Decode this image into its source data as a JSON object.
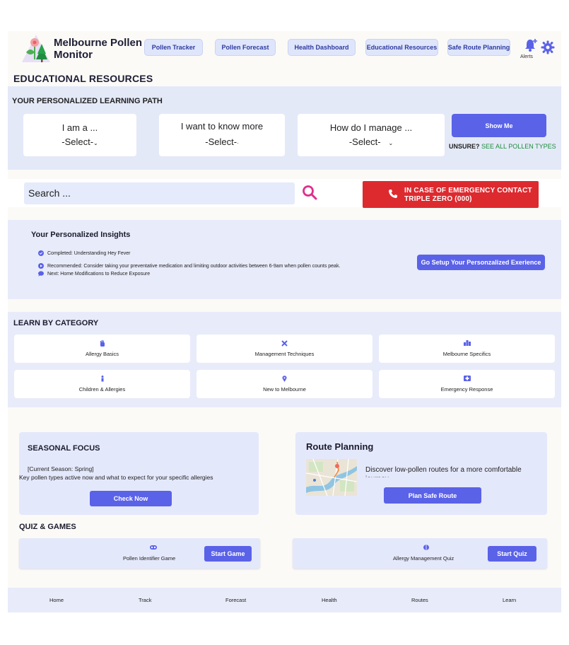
{
  "app": {
    "name_line1": "Melbourne Pollen",
    "name_line2": "Monitor"
  },
  "colors": {
    "primary": "#5a62e8",
    "nav_button_bg": "#dfe6fb",
    "emergency": "#dd2a2f",
    "section_bg": "#e8ebf9",
    "link_green": "#1d8e3b"
  },
  "nav": {
    "items": [
      {
        "label": "Pollen Tracker"
      },
      {
        "label": "Pollen Forecast"
      },
      {
        "label": "Health Dashboard"
      },
      {
        "label": "Educational Resources"
      },
      {
        "label": "Safe Route Planning"
      }
    ],
    "alerts_label": "Alerts",
    "alerts_icon": "bell-plus-icon",
    "settings_icon": "gear-icon"
  },
  "page_title": "EDUCATIONAL RESOURCES",
  "learning_path": {
    "title": "YOUR PERSONALIZED LEARNING PATH",
    "selectors": [
      {
        "prompt": "I am a ...",
        "value": "-Select-"
      },
      {
        "prompt": "I want to know more",
        "value": "-Select-"
      },
      {
        "prompt": "How do I manage ...",
        "value": "-Select-"
      }
    ],
    "show_me": "Show Me",
    "unsure_prefix": "UNSURE?",
    "unsure_link": "SEE ALL POLLEN TYPES"
  },
  "search": {
    "placeholder": "Search ...",
    "icon": "search-icon"
  },
  "emergency": {
    "line1": "IN CASE OF EMERGENCY CONTACT",
    "line2": "TRIPLE ZERO (000)",
    "icon": "phone-icon"
  },
  "insights": {
    "title": "Your Personalized Insights",
    "items": [
      {
        "icon": "check-circle-icon",
        "text": "Completed: Understanding Hey Fever"
      },
      {
        "icon": "play-circle-icon",
        "text": "Recommended: Consider taking your preventative medication and limiting outdoor activities between 6-9am when pollen counts peak."
      },
      {
        "icon": "comment-icon",
        "text": "Next: Home Modifications to Reduce Exposure"
      }
    ],
    "setup_button": "Go Setup Your Personzalized Exerience"
  },
  "categories": {
    "title": "LEARN BY CATEGORY",
    "items": [
      {
        "label": "Allergy Basics",
        "icon": "hand-icon"
      },
      {
        "label": "Management Techniques",
        "icon": "tools-icon"
      },
      {
        "label": "Melbourne Specifics",
        "icon": "city-icon"
      },
      {
        "label": "Children & Allergies",
        "icon": "child-icon"
      },
      {
        "label": "New to Melbourne",
        "icon": "map-pin-icon"
      },
      {
        "label": "Emergency Response",
        "icon": "first-aid-icon"
      }
    ]
  },
  "seasonal": {
    "title": "SEASONAL FOCUS",
    "season": "[Current Season: Spring]",
    "description": "Key pollen types active now and what to expect for your specific allergies",
    "button": "Check Now"
  },
  "route": {
    "title": "Route Planning",
    "description": "Discover low-pollen routes for a more comfortable journey",
    "button": "Plan Safe Route"
  },
  "quiz": {
    "title": "QUIZ & GAMES",
    "cards": [
      {
        "label": "Pollen Identifier Game",
        "button": "Start Game",
        "icon": "gamepad-icon"
      },
      {
        "label": "Allergy Management Quiz",
        "button": "Start Quiz",
        "icon": "brain-icon"
      }
    ]
  },
  "bottom_nav": [
    "Home",
    "Track",
    "Forecast",
    "Health",
    "Routes",
    "Learn"
  ]
}
